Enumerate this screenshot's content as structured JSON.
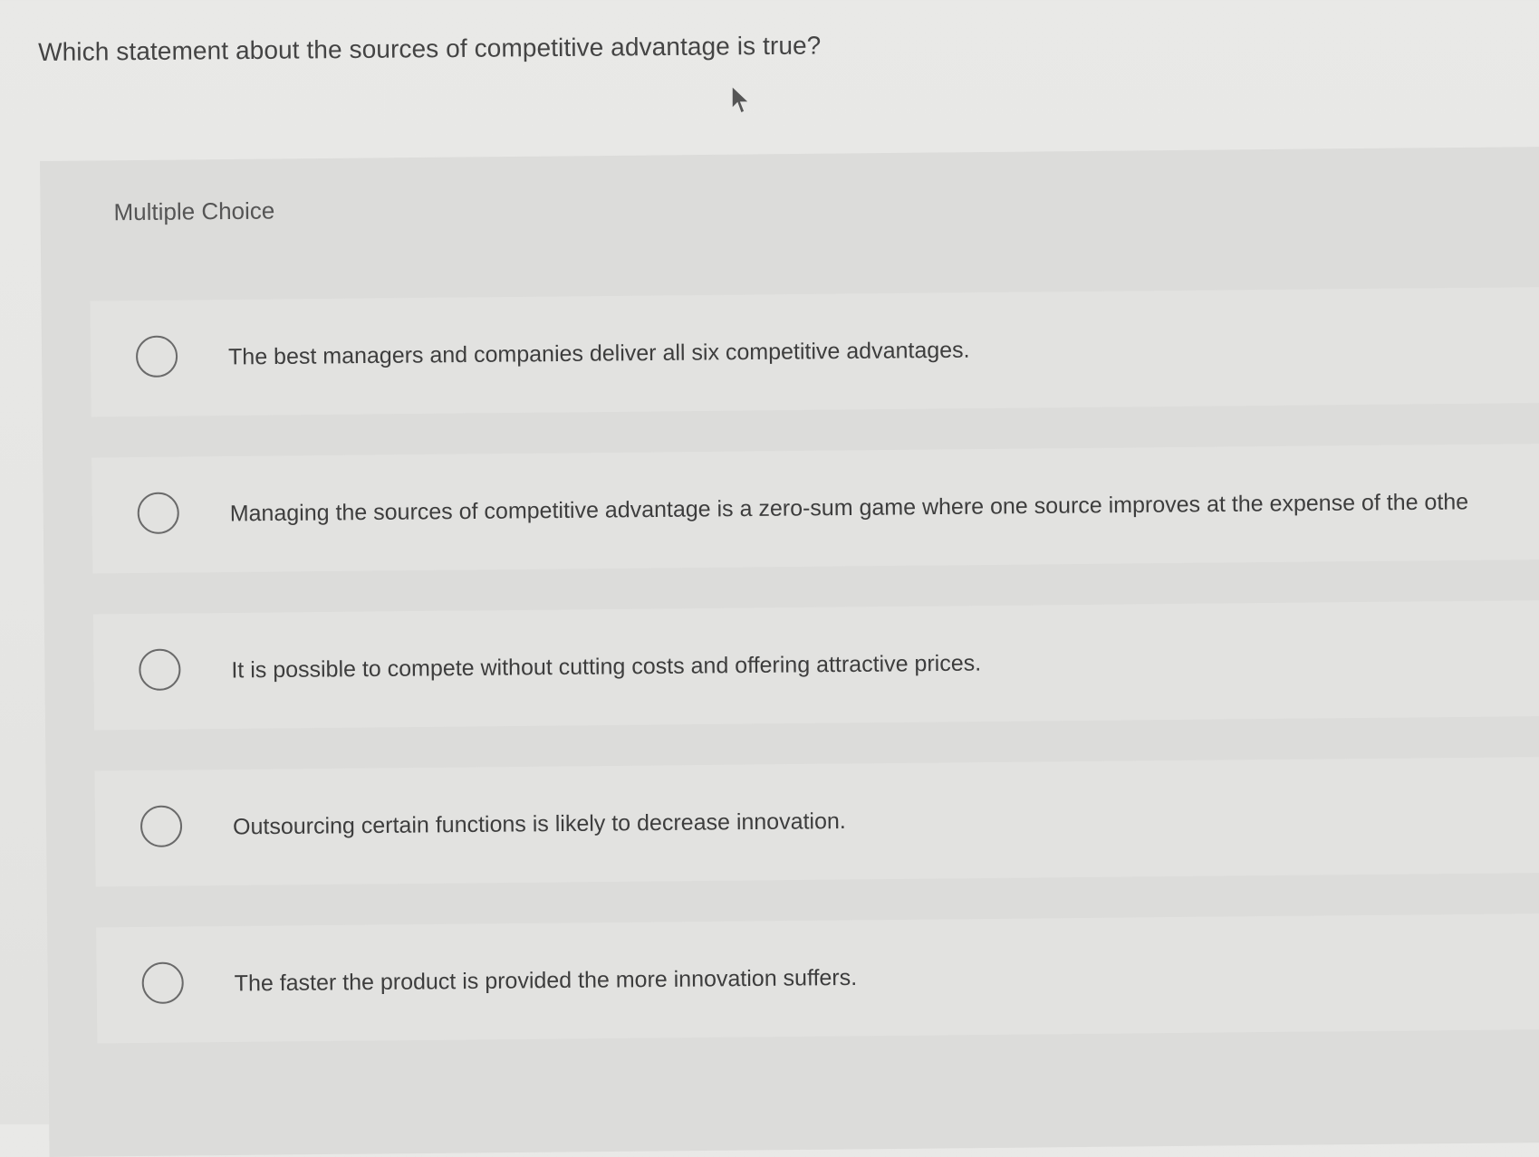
{
  "question": {
    "text": "Which statement about the sources of competitive advantage is true?"
  },
  "section": {
    "label": "Multiple Choice"
  },
  "options": [
    {
      "text": "The best managers and companies deliver all six competitive advantages."
    },
    {
      "text": "Managing the sources of competitive advantage is a zero-sum game where one source improves at the expense of the othe"
    },
    {
      "text": "It is possible to compete without cutting costs and offering attractive prices."
    },
    {
      "text": "Outsourcing certain functions is likely to decrease innovation."
    },
    {
      "text": "The faster the product is provided the more innovation suffers."
    }
  ],
  "icons": {
    "cursor": "mouse-pointer-icon",
    "radio": "radio-unselected-icon"
  }
}
